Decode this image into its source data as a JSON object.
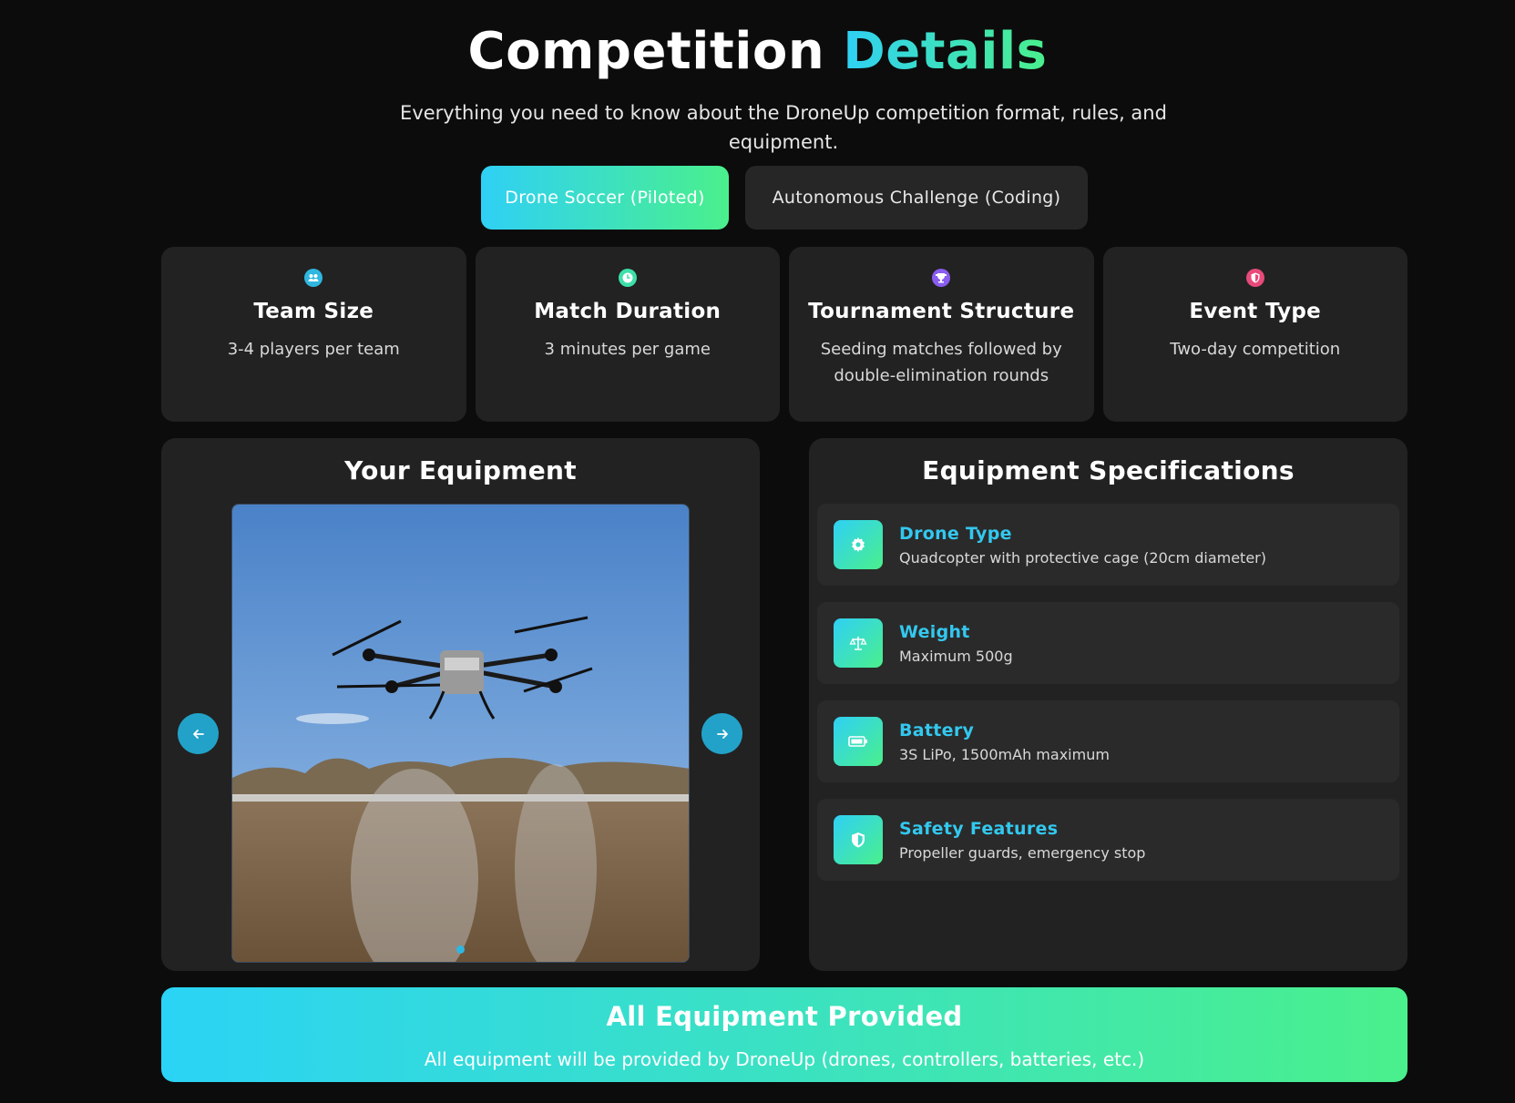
{
  "header": {
    "title_main": "Competition",
    "title_accent": "Details",
    "subtitle": "Everything you need to know about the DroneUp competition format, rules, and equipment."
  },
  "tabs": [
    {
      "label": "Drone Soccer (Piloted)",
      "active": true
    },
    {
      "label": "Autonomous Challenge (Coding)",
      "active": false
    }
  ],
  "info_cards": [
    {
      "icon": "team-icon",
      "title": "Team Size",
      "description": "3-4 players per team"
    },
    {
      "icon": "clock-icon",
      "title": "Match Duration",
      "description": "3 minutes per game"
    },
    {
      "icon": "trophy-icon",
      "title": "Tournament Structure",
      "description": "Seeding matches followed by double-elimination rounds"
    },
    {
      "icon": "shield-icon",
      "title": "Event Type",
      "description": "Two-day competition"
    }
  ],
  "equipment": {
    "title": "Your Equipment",
    "image_alt": "drone-photo",
    "prev_icon": "arrow-left-icon",
    "next_icon": "arrow-right-icon"
  },
  "specifications": {
    "title": "Equipment Specifications",
    "items": [
      {
        "icon": "gear-icon",
        "name": "Drone Type",
        "value": "Quadcopter with protective cage (20cm diameter)"
      },
      {
        "icon": "scale-icon",
        "name": "Weight",
        "value": "Maximum 500g"
      },
      {
        "icon": "battery-icon",
        "name": "Battery",
        "value": "3S LiPo, 1500mAh maximum"
      },
      {
        "icon": "shield-icon",
        "name": "Safety Features",
        "value": "Propeller guards, emergency stop"
      }
    ]
  },
  "banner": {
    "title": "All Equipment Provided",
    "description": "All equipment will be provided by DroneUp (drones, controllers, batteries, etc.)"
  },
  "colors": {
    "background": "#0c0c0c",
    "panel": "#222222",
    "accent_start": "#2fd0f5",
    "accent_end": "#4af08c",
    "spec_name": "#33c8ef"
  }
}
